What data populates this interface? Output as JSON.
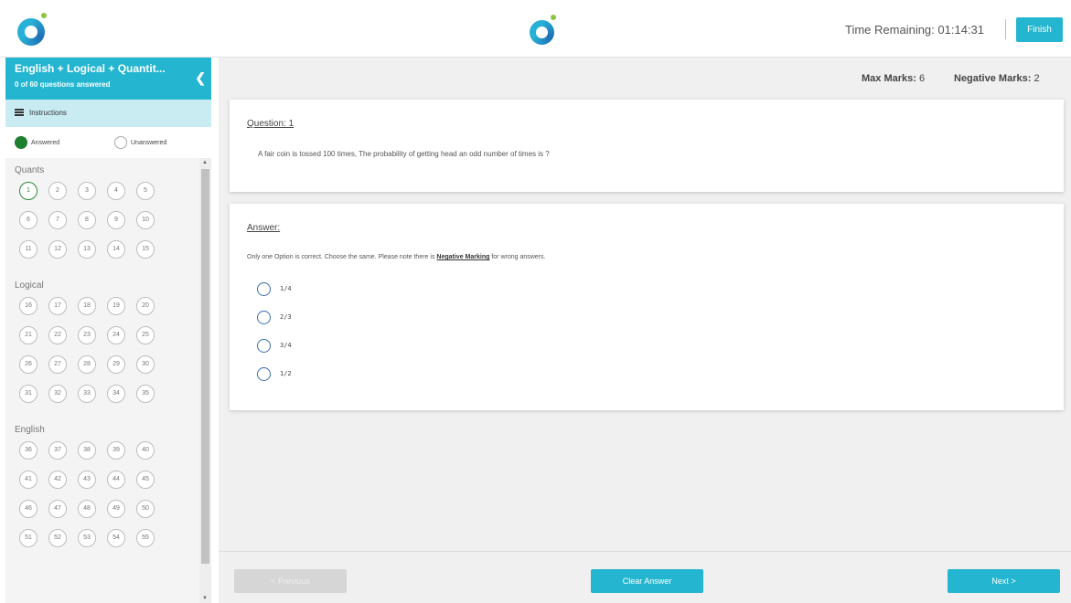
{
  "header": {
    "timer_label": "Time Remaining:",
    "timer_value": "01:14:31",
    "finish_label": "Finish"
  },
  "sidebar": {
    "section_title": "English + Logical + Quantit...",
    "section_subtitle": "0 of 60 questions answered",
    "collapse_icon": "chevron-left-icon",
    "instructions_label": "Instructions",
    "legend": {
      "answered_label": "Answered",
      "unanswered_label": "Unanswered",
      "answered_color": "#1e7f2f"
    },
    "groups": [
      {
        "label": "Quants",
        "questions": [
          "1",
          "2",
          "3",
          "4",
          "5",
          "6",
          "7",
          "8",
          "9",
          "10",
          "11",
          "12",
          "13",
          "14",
          "15"
        ]
      },
      {
        "label": "Logical",
        "questions": [
          "16",
          "17",
          "18",
          "19",
          "20",
          "21",
          "22",
          "23",
          "24",
          "25",
          "26",
          "27",
          "28",
          "29",
          "30",
          "31",
          "32",
          "33",
          "34",
          "35"
        ]
      },
      {
        "label": "English",
        "questions": [
          "36",
          "37",
          "38",
          "39",
          "40",
          "41",
          "42",
          "43",
          "44",
          "45",
          "46",
          "47",
          "48",
          "49",
          "50",
          "51",
          "52",
          "53",
          "54",
          "55"
        ]
      }
    ],
    "current_question": "1"
  },
  "main": {
    "max_marks_label": "Max Marks:",
    "max_marks_value": "6",
    "negative_marks_label": "Negative Marks:",
    "negative_marks_value": "2",
    "question": {
      "title": "Question: 1",
      "text": "A fair coin is tossed 100 times, The probability of getting head an odd number of times is ?"
    },
    "answer": {
      "title": "Answer:",
      "instruction_prefix": "Only one Option is correct. Choose the same. Please note there is",
      "instruction_emphasis": "Negative Marking",
      "instruction_suffix": "for wrong answers.",
      "options": [
        "1/4",
        "2/3",
        "3/4",
        "1/2"
      ]
    }
  },
  "footer": {
    "previous_label": "< Previous",
    "clear_label": "Clear Answer",
    "next_label": "Next >"
  },
  "colors": {
    "accent": "#24b6d0",
    "instructions_bg": "#c9ecf3"
  }
}
